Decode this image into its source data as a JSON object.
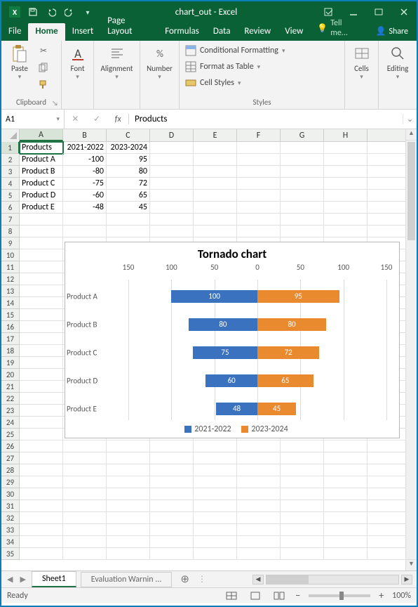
{
  "title": "chart_out - Excel",
  "menu": {
    "file": "File",
    "home": "Home",
    "insert": "Insert",
    "pagelayout": "Page Layout",
    "formulas": "Formulas",
    "data": "Data",
    "review": "Review",
    "view": "View",
    "tell": "Tell me...",
    "share": "Share"
  },
  "ribbon": {
    "clipboard": {
      "label": "Clipboard",
      "paste": "Paste"
    },
    "font": {
      "label": "Font",
      "btn": "Font"
    },
    "alignment": {
      "label": "Alignment",
      "btn": "Alignment"
    },
    "number": {
      "label": "Number",
      "btn": "Number"
    },
    "styles": {
      "label": "Styles",
      "cf": "Conditional Formatting",
      "fat": "Format as Table",
      "cs": "Cell Styles"
    },
    "cells": {
      "label": "Cells",
      "btn": "Cells"
    },
    "editing": {
      "label": "Editing",
      "btn": "Editing"
    }
  },
  "namebox": "A1",
  "formula": "Products",
  "columns": [
    "A",
    "B",
    "C",
    "D",
    "E",
    "F",
    "G",
    "H"
  ],
  "data": {
    "headers": [
      "Products",
      "2021-2022",
      "2023-2024"
    ],
    "rows": [
      [
        "Product A",
        -100,
        95
      ],
      [
        "Product B",
        -80,
        80
      ],
      [
        "Product C",
        -75,
        72
      ],
      [
        "Product D",
        -60,
        65
      ],
      [
        "Product E",
        -48,
        45
      ]
    ]
  },
  "chart_data": {
    "type": "bar",
    "title": "Tornado chart",
    "categories": [
      "Product A",
      "Product B",
      "Product C",
      "Product D",
      "Product E"
    ],
    "series": [
      {
        "name": "2021-2022",
        "values": [
          -100,
          -80,
          -75,
          -60,
          -48
        ],
        "display": [
          100,
          80,
          75,
          60,
          48
        ],
        "color": "#3a72bf"
      },
      {
        "name": "2023-2024",
        "values": [
          95,
          80,
          72,
          65,
          45
        ],
        "display": [
          95,
          80,
          72,
          65,
          45
        ],
        "color": "#ea8a2e"
      }
    ],
    "xticks": [
      -150,
      -100,
      -50,
      0,
      50,
      100,
      150
    ],
    "xtick_labels": [
      "150",
      "100",
      "50",
      "0",
      "50",
      "100",
      "150"
    ],
    "xlim": [
      -150,
      150
    ]
  },
  "sheets": {
    "active": "Sheet1",
    "other": "Evaluation Warnin  ..."
  },
  "status": {
    "ready": "Ready",
    "zoom": "100%"
  }
}
